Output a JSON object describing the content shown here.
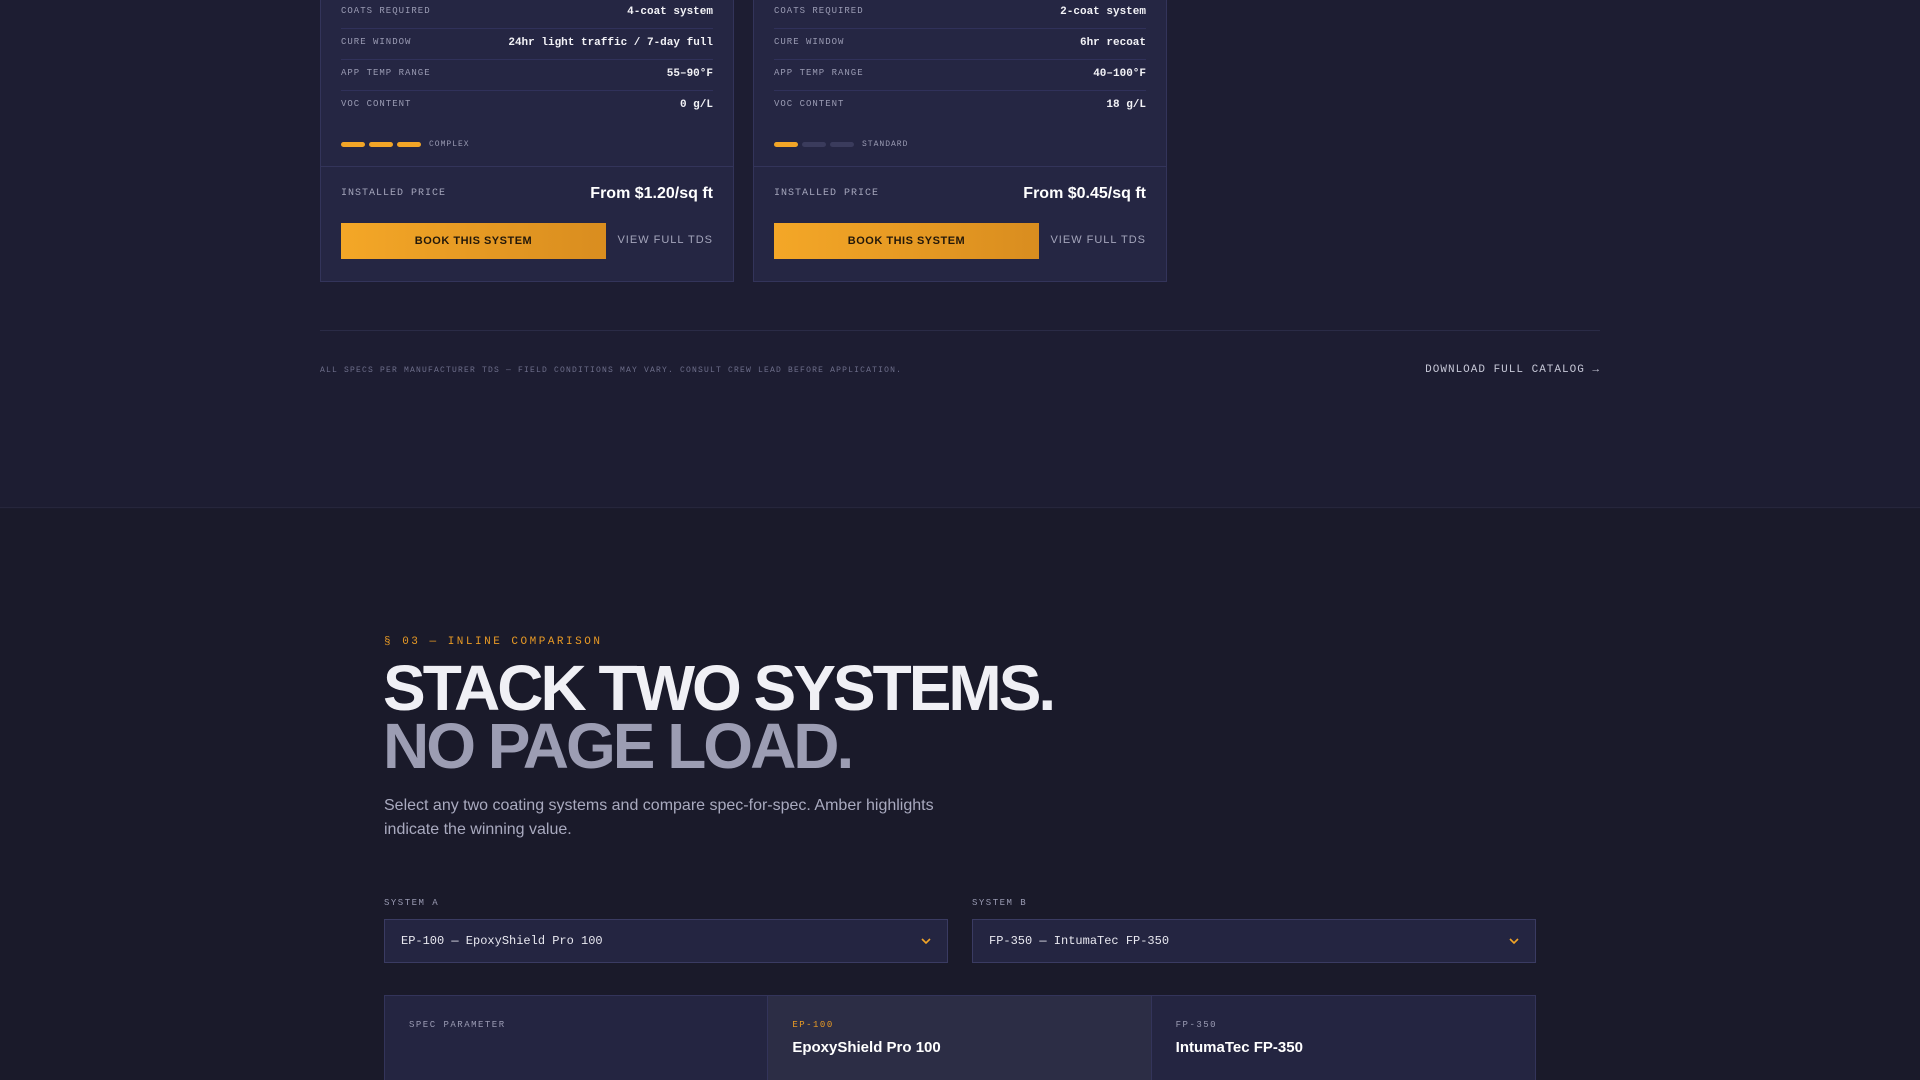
{
  "cards": [
    {
      "specs": [
        {
          "label": "COATS REQUIRED",
          "value": "4-coat system"
        },
        {
          "label": "CURE WINDOW",
          "value": "24hr light traffic / 7-day full"
        },
        {
          "label": "APP TEMP RANGE",
          "value": "55–90°F"
        },
        {
          "label": "VOC CONTENT",
          "value": "0 g/L"
        }
      ],
      "complexity": {
        "level": 3,
        "of": 3,
        "label": "COMPLEX"
      },
      "price_label": "INSTALLED PRICE",
      "price": "From $1.20/sq ft",
      "book_label": "BOOK THIS SYSTEM",
      "tds_label": "VIEW FULL TDS"
    },
    {
      "specs": [
        {
          "label": "COATS REQUIRED",
          "value": "2-coat system"
        },
        {
          "label": "CURE WINDOW",
          "value": "6hr recoat"
        },
        {
          "label": "APP TEMP RANGE",
          "value": "40–100°F"
        },
        {
          "label": "VOC CONTENT",
          "value": "18 g/L"
        }
      ],
      "complexity": {
        "level": 1,
        "of": 3,
        "label": "STANDARD"
      },
      "price_label": "INSTALLED PRICE",
      "price": "From $0.45/sq ft",
      "book_label": "BOOK THIS SYSTEM",
      "tds_label": "VIEW FULL TDS"
    }
  ],
  "footer": {
    "note": "ALL SPECS PER MANUFACTURER TDS — FIELD CONDITIONS MAY VARY. CONSULT CREW LEAD BEFORE APPLICATION.",
    "catalog_link": "DOWNLOAD FULL CATALOG →"
  },
  "comparison": {
    "eyebrow": "§ 03 — INLINE COMPARISON",
    "headline_1": "STACK TWO SYSTEMS.",
    "headline_2": "NO PAGE LOAD.",
    "subcopy": "Select any two coating systems and compare spec-for-spec. Amber highlights indicate the winning value.",
    "system_a": {
      "label": "SYSTEM A",
      "selected": "EP-100 — EpoxyShield Pro 100"
    },
    "system_b": {
      "label": "SYSTEM B",
      "selected": "FP-350 — IntumaTec FP-350"
    },
    "table": {
      "param_header": "SPEC PARAMETER",
      "col_a": {
        "code": "EP-100",
        "name": "EpoxyShield Pro 100"
      },
      "col_b": {
        "code": "FP-350",
        "name": "IntumaTec FP-350"
      }
    }
  },
  "colors": {
    "accent": "#f2a527",
    "background": "#1a1a2a",
    "card": "#252643"
  },
  "icons": {
    "select_chevron": "chevron-down-icon"
  }
}
